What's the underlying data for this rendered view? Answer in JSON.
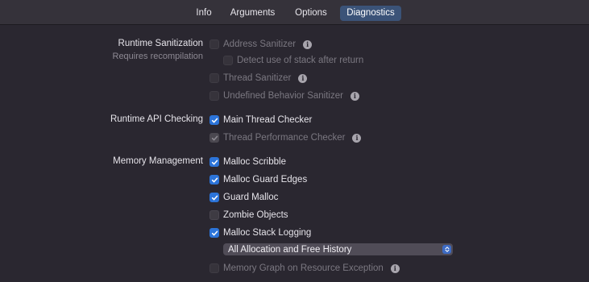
{
  "tabs": [
    {
      "label": "Info"
    },
    {
      "label": "Arguments"
    },
    {
      "label": "Options"
    },
    {
      "label": "Diagnostics"
    }
  ],
  "active_tab": "Diagnostics",
  "sections": {
    "runtime_sanitization": {
      "label": "Runtime Sanitization",
      "sublabel": "Requires recompilation",
      "address_sanitizer": {
        "label": "Address Sanitizer",
        "checked": false,
        "enabled": false
      },
      "detect_stack": {
        "label": "Detect use of stack after return",
        "checked": false,
        "enabled": false
      },
      "thread_sanitizer": {
        "label": "Thread Sanitizer",
        "checked": false,
        "enabled": false
      },
      "ub_sanitizer": {
        "label": "Undefined Behavior Sanitizer",
        "checked": false,
        "enabled": false
      }
    },
    "runtime_api": {
      "label": "Runtime API Checking",
      "main_thread_checker": {
        "label": "Main Thread Checker",
        "checked": true,
        "enabled": true
      },
      "thread_perf_checker": {
        "label": "Thread Performance Checker",
        "checked": true,
        "enabled": false
      }
    },
    "memory": {
      "label": "Memory Management",
      "malloc_scribble": {
        "label": "Malloc Scribble",
        "checked": true,
        "enabled": true
      },
      "malloc_guard_edges": {
        "label": "Malloc Guard Edges",
        "checked": true,
        "enabled": true
      },
      "guard_malloc": {
        "label": "Guard Malloc",
        "checked": true,
        "enabled": true
      },
      "zombie_objects": {
        "label": "Zombie Objects",
        "checked": false,
        "enabled": true
      },
      "malloc_stack_logging": {
        "label": "Malloc Stack Logging",
        "checked": true,
        "enabled": true
      },
      "stack_logging_mode": {
        "value": "All Allocation and Free History"
      },
      "memory_graph": {
        "label": "Memory Graph on Resource Exception",
        "checked": false,
        "enabled": false
      }
    }
  },
  "icons": {
    "info": "info-icon",
    "checkmark": "checkmark-icon",
    "stepper": "chevron-up-down-icon"
  },
  "colors": {
    "background": "#2a2730",
    "tab_active": "#3b5378",
    "checkbox_on": "#2c74d9",
    "popup": "#504c57"
  }
}
